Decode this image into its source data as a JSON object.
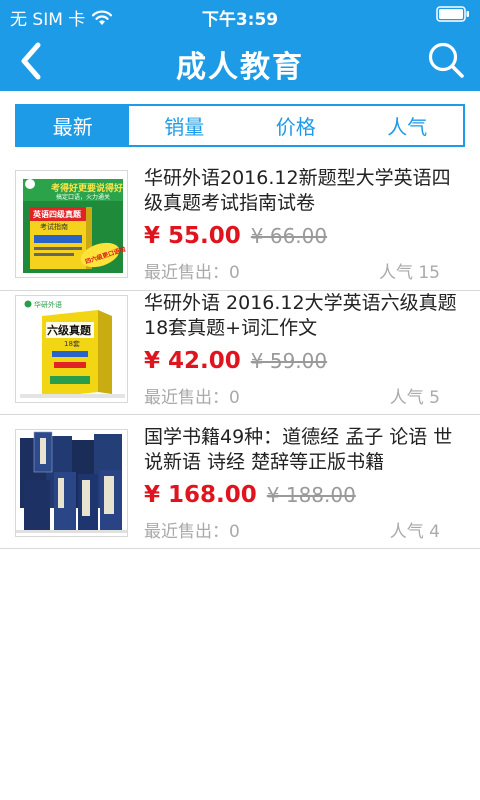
{
  "status_bar": {
    "carrier": "无 SIM 卡",
    "time": "下午3:59"
  },
  "nav": {
    "title": "成人教育",
    "back_icon": "chevron-left-icon",
    "search_icon": "search-icon"
  },
  "tabs": [
    {
      "label": "最新",
      "active": true
    },
    {
      "label": "销量",
      "active": false
    },
    {
      "label": "价格",
      "active": false
    },
    {
      "label": "人气",
      "active": false
    }
  ],
  "products": [
    {
      "title": "华研外语2016.12新题型大学英语四级真题考试指南试卷",
      "price": "¥ 55.00",
      "old_price": "¥ 66.00",
      "sold": "最近售出：0",
      "popularity": "人气 15",
      "cover_texts": {
        "banner": "考得好更要说得好",
        "banner_sub": "搞定口语，火力通关",
        "main": "英语四级真题",
        "main_sub": "考试指南",
        "sticker": "四六级更口语啦"
      }
    },
    {
      "title": "华研外语 2016.12大学英语六级真题18套真题+词汇作文",
      "price": "¥ 42.00",
      "old_price": "¥ 59.00",
      "sold": "最近售出：0",
      "popularity": "人气 5",
      "cover_texts": {
        "publisher": "华研外语",
        "main": "六级真题",
        "main_sub": "18套"
      }
    },
    {
      "title": "国学书籍49种：道德经 孟子 论语 世说新语 诗经 楚辞等正版书籍",
      "price": "¥ 168.00",
      "old_price": "¥ 188.00",
      "sold": "最近售出：0",
      "popularity": "人气 4",
      "cover_texts": {}
    }
  ],
  "colors": {
    "brand_blue": "#1e9be6",
    "price_red": "#e0141e",
    "muted_gray": "#aaaaaa"
  }
}
